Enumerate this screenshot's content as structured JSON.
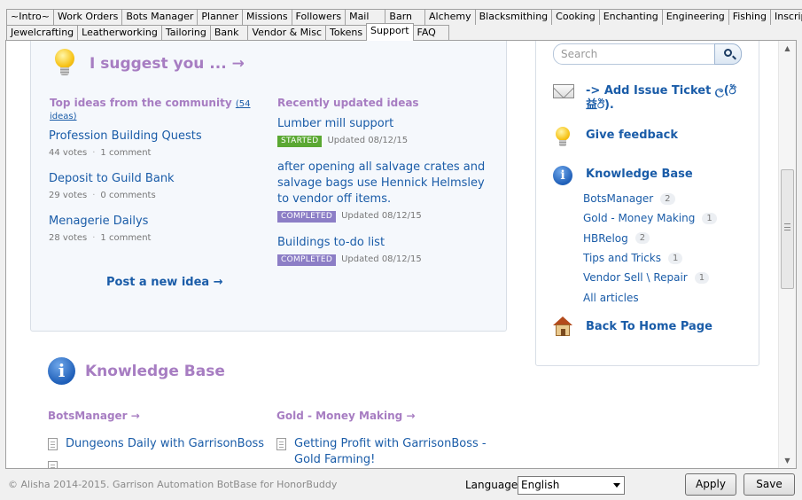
{
  "tabs": {
    "row1": [
      "~Intro~",
      "Work Orders",
      "Bots Manager",
      "Planner",
      "Missions",
      "Followers",
      "Mail",
      "Barn",
      "Alchemy",
      "Blacksmithing",
      "Cooking",
      "Enchanting",
      "Engineering",
      "Fishing",
      "Inscription"
    ],
    "row2": [
      "Jewelcrafting",
      "Leatherworking",
      "Tailoring",
      "Bank",
      "Vendor & Misc",
      "Tokens",
      "Support",
      "FAQ"
    ],
    "active": "Support"
  },
  "ideas": {
    "title": "I suggest you ... →",
    "top_heading": "Top ideas from the community",
    "top_count": "(54 ideas)",
    "recent_heading": "Recently updated ideas",
    "top_ideas": [
      {
        "title": "Profession Building Quests",
        "votes": "44 votes",
        "comments": "1 comment"
      },
      {
        "title": "Deposit to Guild Bank",
        "votes": "29 votes",
        "comments": "0 comments"
      },
      {
        "title": "Menagerie Dailys",
        "votes": "28 votes",
        "comments": "1 comment"
      }
    ],
    "recent_ideas": [
      {
        "title": "Lumber mill support",
        "status": "STARTED",
        "updated": "Updated 08/12/15"
      },
      {
        "title": "after opening all salvage crates and salvage bags use Hennick Helmsley to vendor off items.",
        "status": "COMPLETED",
        "updated": "Updated 08/12/15"
      },
      {
        "title": "Buildings to-do list",
        "status": "COMPLETED",
        "updated": "Updated 08/12/15"
      }
    ],
    "post_link": "Post a new idea →"
  },
  "knowledge_base": {
    "title": "Knowledge Base",
    "col1_heading": "BotsManager →",
    "col2_heading": "Gold - Money Making →",
    "col1_articles": [
      "Dungeons Daily with GarrisonBoss"
    ],
    "col2_articles": [
      "Getting Profit with GarrisonBoss - Gold Farming!"
    ]
  },
  "sidebar": {
    "search_placeholder": "Search",
    "add_ticket": "-> Add Issue Ticket ල(ඊ益ඊ). ",
    "give_feedback": "Give feedback",
    "kb_title": "Knowledge Base",
    "kb_items": [
      {
        "label": "BotsManager",
        "count": "2"
      },
      {
        "label": "Gold - Money Making",
        "count": "1"
      },
      {
        "label": "HBRelog",
        "count": "2"
      },
      {
        "label": "Tips and Tricks",
        "count": "1"
      },
      {
        "label": "Vendor Sell \\ Repair",
        "count": "1"
      },
      {
        "label": "All articles",
        "count": ""
      }
    ],
    "back_home": "Back To Home Page"
  },
  "footer": {
    "copyright": "© Alisha 2014-2015. Garrison Automation BotBase for HonorBuddy",
    "language_label": "Language",
    "language_value": "English",
    "apply_label": "Apply",
    "save_label": "Save"
  },
  "colors": {
    "accent_purple": "#a77dc2",
    "link_blue": "#1a5ca8",
    "started_green": "#5aa832",
    "completed_purple": "#8c7ec6"
  }
}
